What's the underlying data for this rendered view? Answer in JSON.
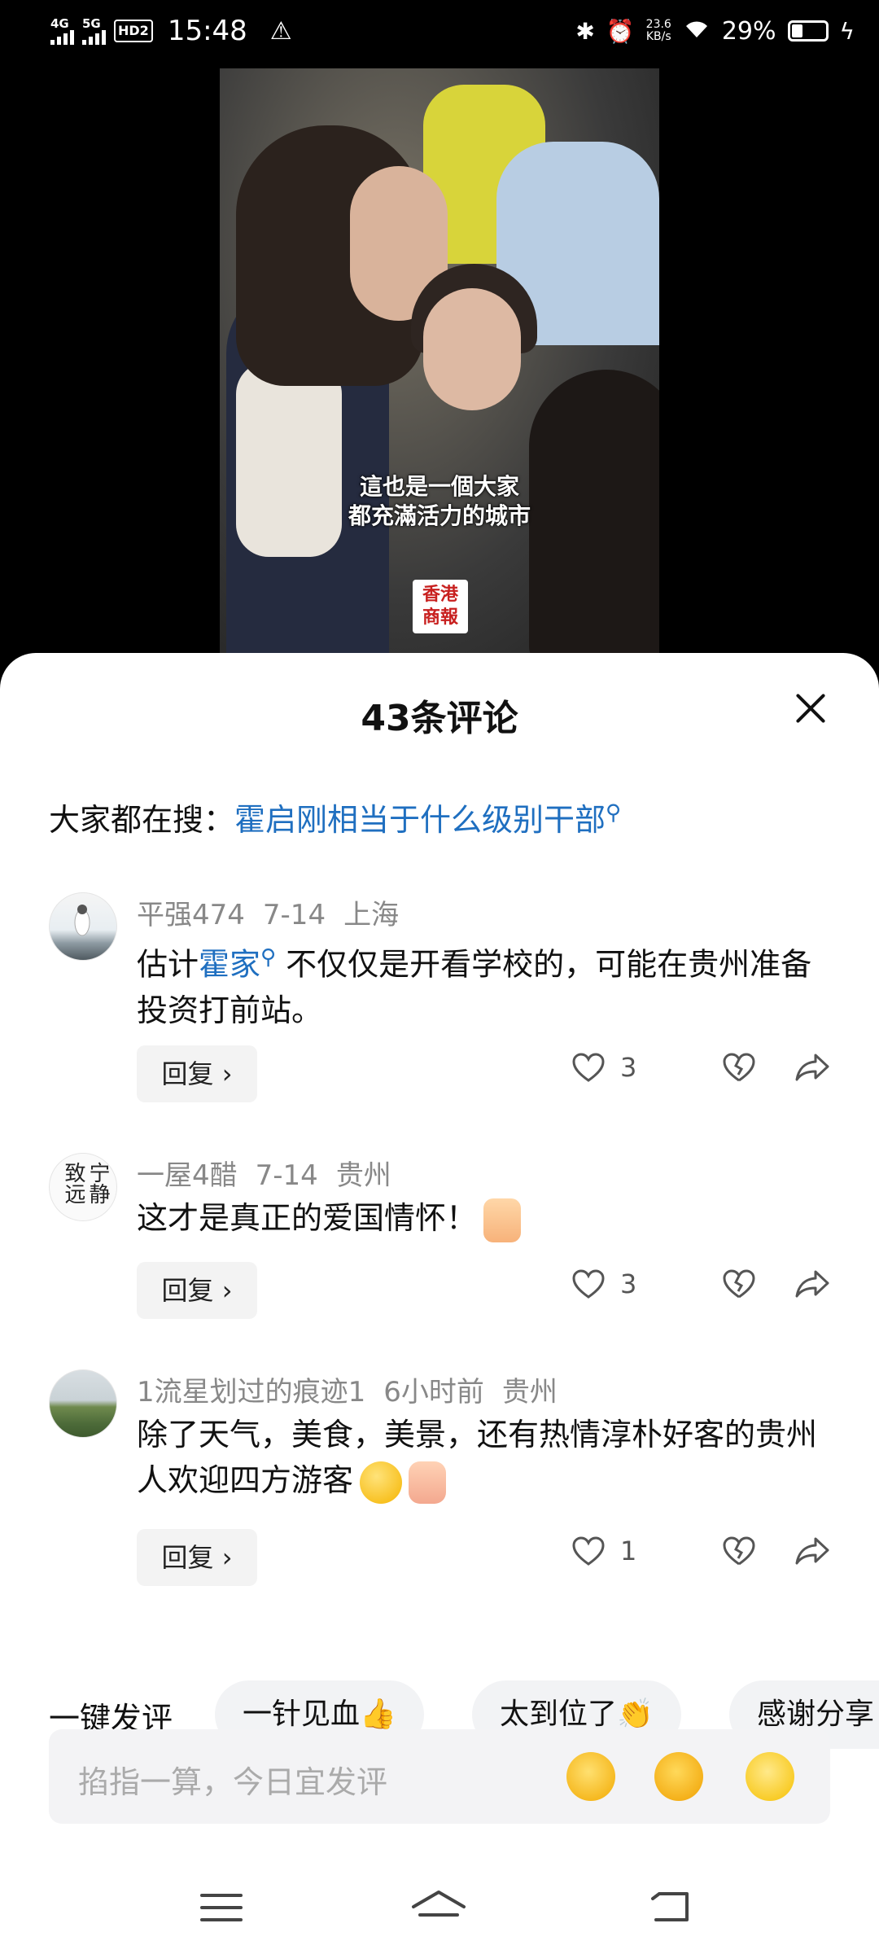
{
  "status_bar": {
    "net1": "4G",
    "net2": "5G",
    "hd": "HD2",
    "time": "15:48",
    "speed_value": "23.6",
    "speed_unit": "KB/s",
    "battery": "29%"
  },
  "video": {
    "subtitle_line1": "這也是一個大家",
    "subtitle_line2": "都充滿活力的城市",
    "logo_line1": "香港",
    "logo_line2": "商報"
  },
  "sheet": {
    "title": "43条评论",
    "search_label": "大家都在搜：",
    "search_query": "霍启刚相当于什么级别干部"
  },
  "comments": [
    {
      "user": "平强474",
      "date": "7-14",
      "location": "上海",
      "text_pre": "估计",
      "keyword": "霍家",
      "text_post": " 不仅仅是开看学校的，可能在贵州准备投资打前站。",
      "reply": "回复",
      "likes": "3"
    },
    {
      "user": "一屋4醋",
      "date": "7-14",
      "location": "贵州",
      "text": "这才是真正的爱国情怀！",
      "reply": "回复",
      "likes": "3",
      "avatar_text": "宁静致远"
    },
    {
      "user": "1流星划过的痕迹1",
      "date": "6小时前",
      "location": "贵州",
      "text": "除了天气，美食，美景，还有热情淳朴好客的贵州人欢迎四方游客",
      "reply": "回复",
      "likes": "1"
    }
  ],
  "quick_comments": {
    "label": "一键发评",
    "chips": [
      "一针见血👍",
      "太到位了👏",
      "感谢分享"
    ]
  },
  "input": {
    "placeholder": "掐指一算，今日宜发评"
  },
  "colors": {
    "link": "#1f6fc0",
    "chip_bg": "#f2f3f5"
  }
}
